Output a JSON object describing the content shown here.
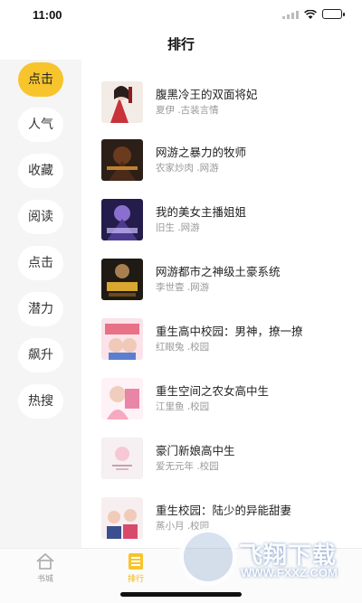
{
  "status": {
    "time": "11:00",
    "battery_level": 0.9,
    "icons": [
      "signal-icon",
      "wifi-icon",
      "battery-icon"
    ]
  },
  "header": {
    "title": "排行"
  },
  "sidebar": {
    "items": [
      {
        "label": "点击",
        "active": true
      },
      {
        "label": "人气",
        "active": false
      },
      {
        "label": "收藏",
        "active": false
      },
      {
        "label": "阅读",
        "active": false
      },
      {
        "label": "点击",
        "active": false
      },
      {
        "label": "潜力",
        "active": false
      },
      {
        "label": "飙升",
        "active": false
      },
      {
        "label": "热搜",
        "active": false
      }
    ]
  },
  "books": [
    {
      "title": "腹黑冷王的双面将妃",
      "meta": "夏伊 .古装言情"
    },
    {
      "title": "网游之暴力的牧师",
      "meta": "农家炒肉 .网游"
    },
    {
      "title": "我的美女主播姐姐",
      "meta": "旧生 .网游"
    },
    {
      "title": "网游都市之神级土豪系统",
      "meta": "李世壹 .网游"
    },
    {
      "title": "重生高中校园：男神，撩一撩",
      "meta": "红眼兔 .校园"
    },
    {
      "title": "重生空间之农女高中生",
      "meta": "江里鱼 .校园"
    },
    {
      "title": "豪门新娘高中生",
      "meta": "爱无元年 .校园"
    },
    {
      "title": "重生校园：陆少的异能甜妻",
      "meta": "蒸小月 .校园"
    }
  ],
  "tabbar": {
    "tabs": [
      {
        "label": "书城",
        "icon": "home-icon"
      },
      {
        "label": "排行",
        "icon": "list-icon"
      }
    ]
  },
  "watermark": {
    "text": "飞翔下载",
    "url": "WWW.FXXZ.COM"
  },
  "colors": {
    "accent": "#f7c42b",
    "sidebar_bg": "#f5f5f5",
    "meta_text": "#999999"
  }
}
